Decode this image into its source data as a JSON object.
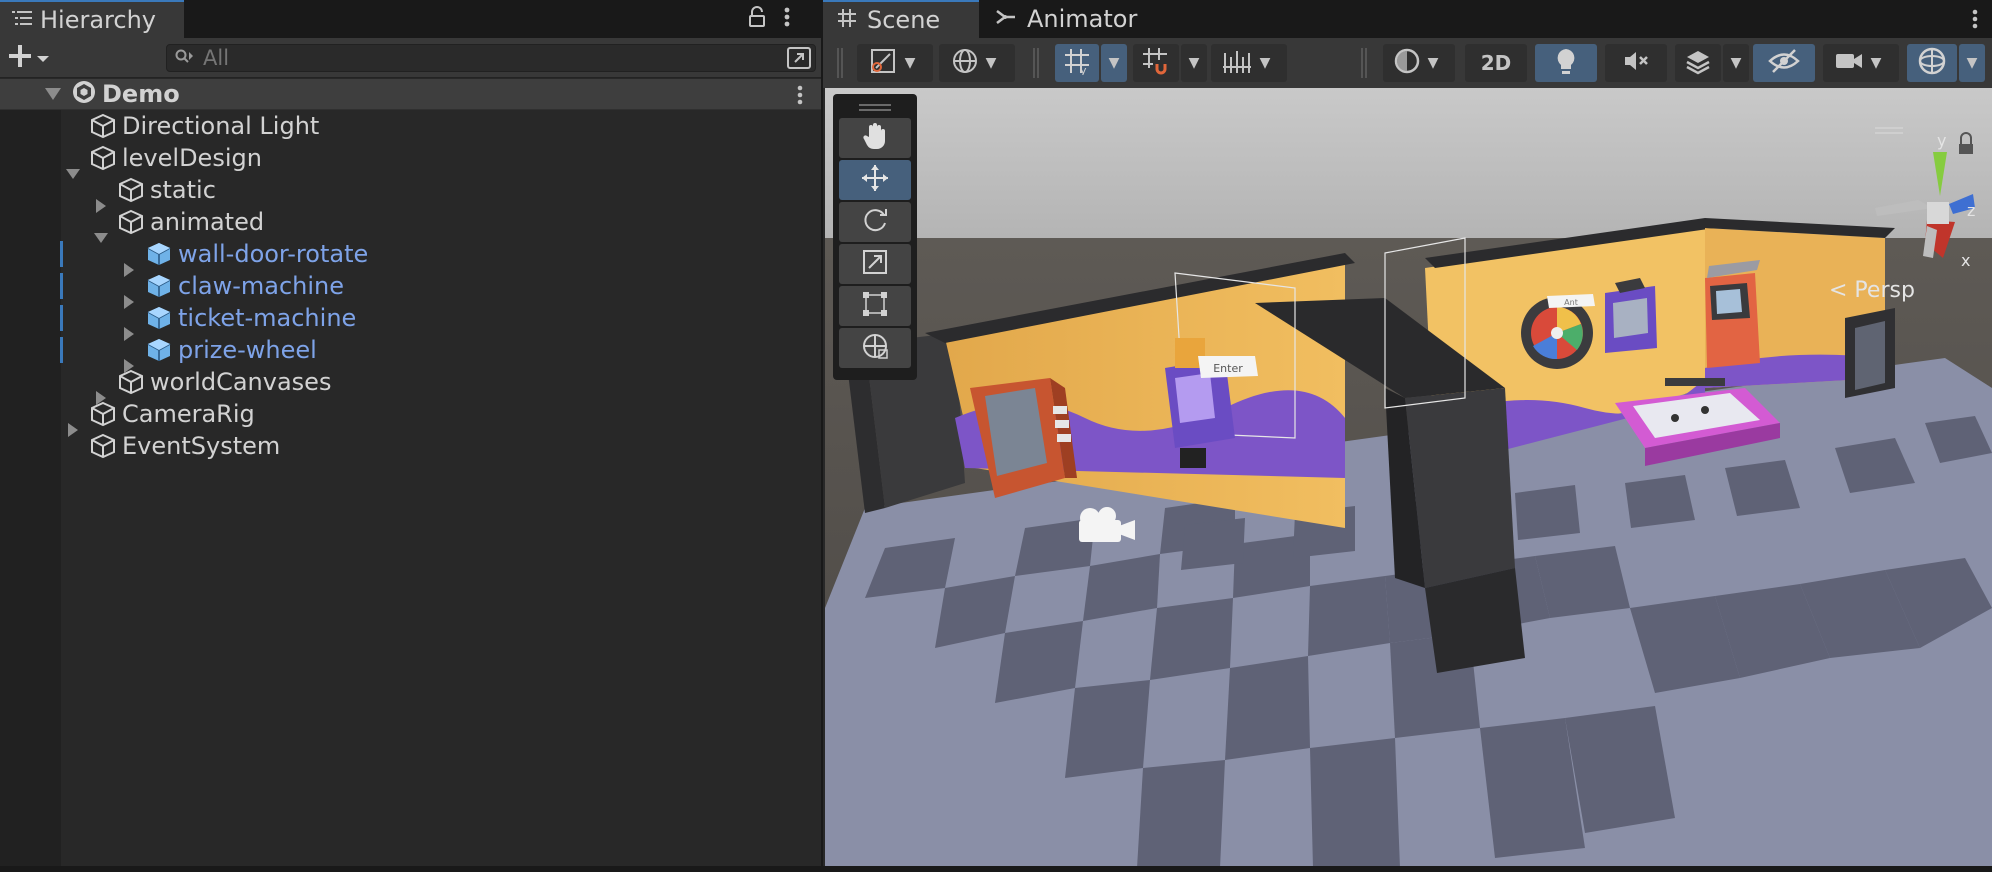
{
  "hierarchy": {
    "tab_label": "Hierarchy",
    "search_placeholder": "All",
    "scene_name": "Demo",
    "rows": [
      {
        "label": "Directional Light",
        "depth": 1,
        "expand": "none",
        "prefab": false
      },
      {
        "label": "levelDesign",
        "depth": 1,
        "expand": "open",
        "prefab": false
      },
      {
        "label": "static",
        "depth": 2,
        "expand": "closed",
        "prefab": false
      },
      {
        "label": "animated",
        "depth": 2,
        "expand": "open",
        "prefab": false
      },
      {
        "label": "wall-door-rotate",
        "depth": 3,
        "expand": "closed",
        "prefab": true
      },
      {
        "label": "claw-machine",
        "depth": 3,
        "expand": "closed",
        "prefab": true
      },
      {
        "label": "ticket-machine",
        "depth": 3,
        "expand": "closed",
        "prefab": true
      },
      {
        "label": "prize-wheel",
        "depth": 3,
        "expand": "closed",
        "prefab": true
      },
      {
        "label": "worldCanvases",
        "depth": 2,
        "expand": "closed",
        "prefab": false
      },
      {
        "label": "CameraRig",
        "depth": 1,
        "expand": "closed",
        "prefab": false
      },
      {
        "label": "EventSystem",
        "depth": 1,
        "expand": "none",
        "prefab": false
      }
    ]
  },
  "scene_view": {
    "tabs": [
      "Scene",
      "Animator"
    ],
    "toggle_2d_label": "2D",
    "projection_label": "< Persp",
    "gizmo_axes": {
      "y": "y",
      "z": "z",
      "x": "x"
    },
    "world_labels": {
      "door_sign": "Enter",
      "wheel_sign": "Ant"
    },
    "tools": [
      "hand-tool",
      "move-tool",
      "rotate-tool",
      "scale-tool",
      "rect-tool",
      "transform-tool"
    ],
    "active_tool": "move-tool"
  },
  "colors": {
    "accent": "#3a79bb",
    "prefab_text": "#7ea3e8",
    "active_button": "#46607c"
  }
}
